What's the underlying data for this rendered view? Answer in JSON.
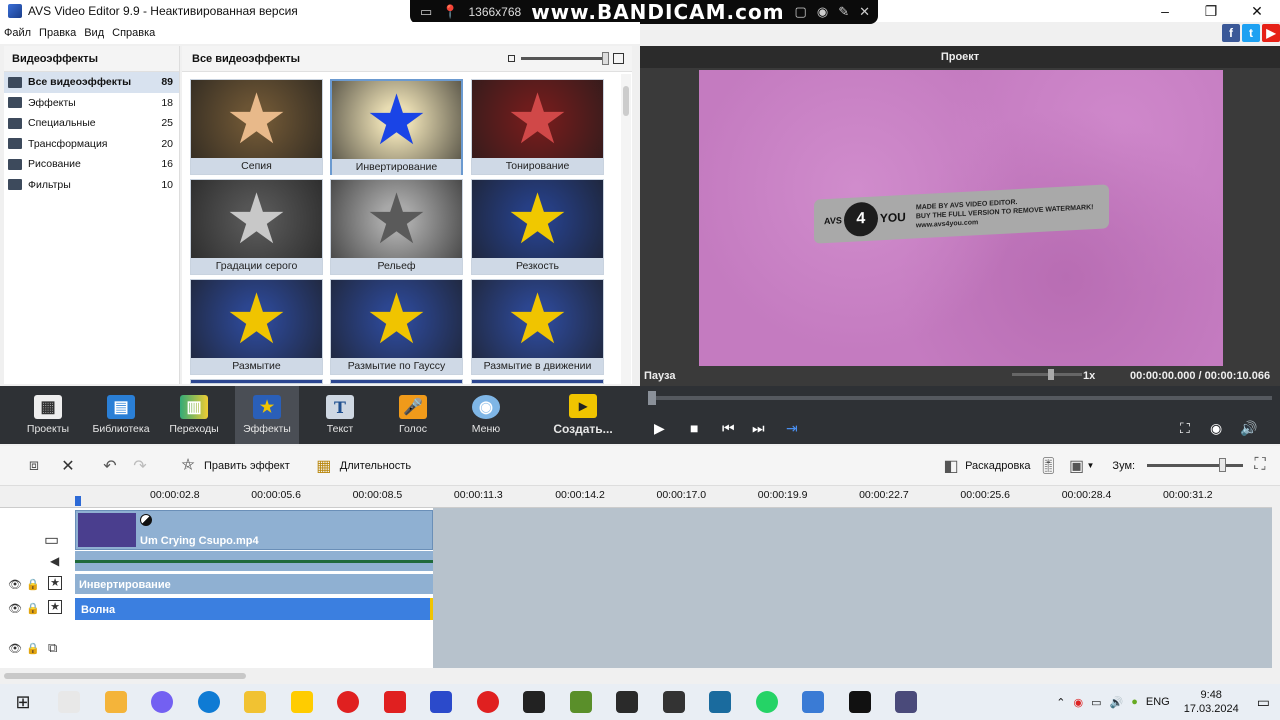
{
  "window": {
    "title": "AVS Video Editor 9.9 - Неактивированная версия",
    "controls": [
      "–",
      "❐",
      "✕"
    ]
  },
  "overlay": {
    "resolution": "1366x768",
    "brand": "www.BANDICAM.com"
  },
  "menu": [
    "Файл",
    "Правка",
    "Вид",
    "Справка"
  ],
  "social": [
    {
      "label": "f",
      "color": "#3b5998"
    },
    {
      "label": "t",
      "color": "#1da1f2"
    },
    {
      "label": "▶",
      "color": "#e62117"
    }
  ],
  "categories": {
    "header": "Видеоэффекты",
    "items": [
      {
        "label": "Все видеоэффекты",
        "count": "89"
      },
      {
        "label": "Эффекты",
        "count": "18"
      },
      {
        "label": "Специальные",
        "count": "25"
      },
      {
        "label": "Трансформация",
        "count": "20"
      },
      {
        "label": "Рисование",
        "count": "16"
      },
      {
        "label": "Фильтры",
        "count": "10"
      }
    ]
  },
  "effects": {
    "header": "Все видеоэффекты",
    "tiles": [
      {
        "label": "Сепия",
        "bg": "#6b5434",
        "star": "#e8b98a"
      },
      {
        "label": "Инвертирование",
        "bg": "#e8dcb2",
        "star": "#1a44e6"
      },
      {
        "label": "Тонирование",
        "bg": "#6e1c1c",
        "star": "#d04848"
      },
      {
        "label": "Градации серого",
        "bg": "#555555",
        "star": "#c8c8c8"
      },
      {
        "label": "Рельеф",
        "bg": "#a8a8a8",
        "star": "#5a5a5a"
      },
      {
        "label": "Резкость",
        "bg": "#263f85",
        "star": "#f0c800"
      },
      {
        "label": "Размытие",
        "bg": "#2c4690",
        "star": "#f0c400"
      },
      {
        "label": "Размытие по Гауссу",
        "bg": "#2c4690",
        "star": "#f0c400"
      },
      {
        "label": "Размытие в движении",
        "bg": "#2c4690",
        "star": "#f0c400"
      }
    ]
  },
  "preview": {
    "header": "Проект",
    "watermark_lines": [
      "MADE BY AVS VIDEO EDITOR.",
      "BUY THE FULL VERSION TO REMOVE WATERMARK!",
      "www.avs4you.com"
    ],
    "logo": "4",
    "logo_prefix": "AVS",
    "logo_suffix": "YOU",
    "status": "Пауза",
    "speed": "1x",
    "time_current": "00:00:00.000",
    "time_separator": "/",
    "time_total": "00:00:10.066"
  },
  "toolbar": [
    {
      "label": "Проекты",
      "icon": "projects-icon"
    },
    {
      "label": "Библиотека",
      "icon": "library-icon"
    },
    {
      "label": "Переходы",
      "icon": "transitions-icon"
    },
    {
      "label": "Эффекты",
      "icon": "effects-icon"
    },
    {
      "label": "Текст",
      "icon": "text-icon"
    },
    {
      "label": "Голос",
      "icon": "voice-icon"
    },
    {
      "label": "Меню",
      "icon": "menu-disc-icon"
    }
  ],
  "toolbar_create": "Создать...",
  "timeline_tools": {
    "edit_effect": "Править эффект",
    "duration": "Длительность",
    "storyboard": "Раскадровка",
    "zoom": "Зум:"
  },
  "ruler": [
    "00:00:02.8",
    "00:00:05.6",
    "00:00:08.5",
    "00:00:11.3",
    "00:00:14.2",
    "00:00:17.0",
    "00:00:19.9",
    "00:00:22.7",
    "00:00:25.6",
    "00:00:28.4",
    "00:00:31.2"
  ],
  "tracks": {
    "clip_name": "Um Crying Csupo.mp4",
    "effect1": "Инвертирование",
    "effect2": "Волна"
  },
  "taskbar": {
    "apps": [
      "#e8e8e8",
      "#f4b43a",
      "#7360f2",
      "#0f7bd4",
      "#f1c232",
      "#ffcc00",
      "#e02020",
      "#e02020",
      "#2b4acb",
      "#e02020",
      "#222222",
      "#5a8f2a",
      "#2a2a2a",
      "#333333",
      "#1a6b9e",
      "#25d366",
      "#3a7bd5",
      "#111111",
      "#4a4a7a"
    ],
    "language": "ENG",
    "time": "9:48",
    "date": "17.03.2024"
  }
}
